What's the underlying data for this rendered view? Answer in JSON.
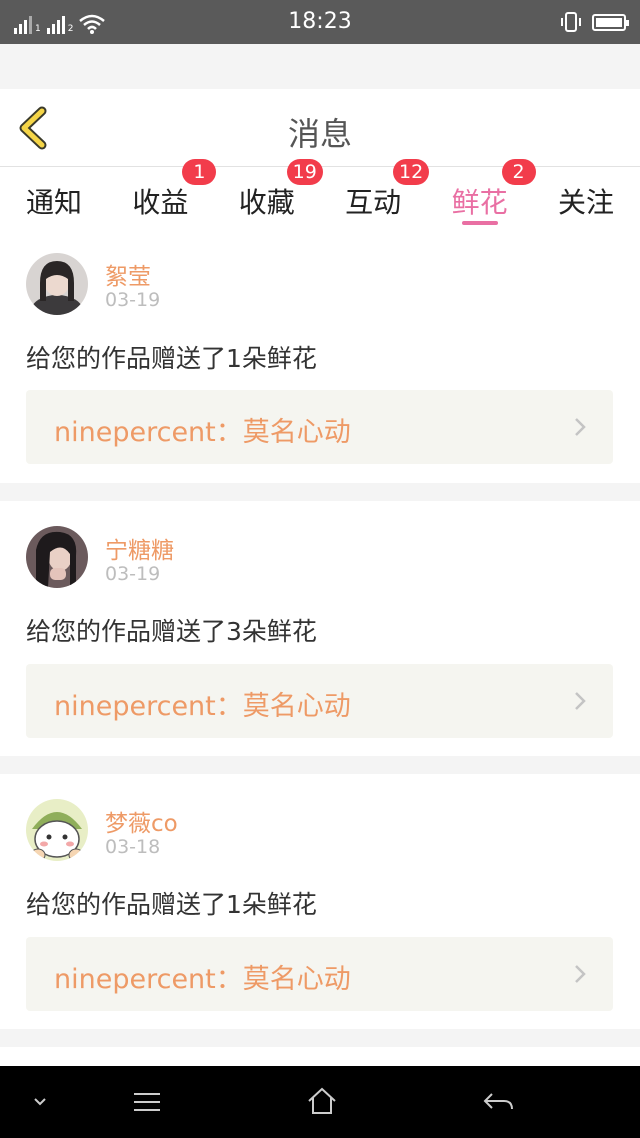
{
  "status_bar": {
    "time": "18:23",
    "sim1_label": "1",
    "sim2_label": "2"
  },
  "header": {
    "title": "消息",
    "back_icon": "chevron-left-icon"
  },
  "tabs": [
    {
      "label": "通知",
      "badge": null,
      "active": false
    },
    {
      "label": "收益",
      "badge": "1",
      "active": false
    },
    {
      "label": "收藏",
      "badge": "19",
      "active": false
    },
    {
      "label": "互动",
      "badge": "12",
      "active": false
    },
    {
      "label": "鲜花",
      "badge": "2",
      "active": true
    },
    {
      "label": "关注",
      "badge": null,
      "active": false
    }
  ],
  "messages": [
    {
      "user": "絮莹",
      "date": "03-19",
      "text": "给您的作品赠送了1朵鲜花",
      "work": "ninepercent：莫名心动"
    },
    {
      "user": "宁糖糖",
      "date": "03-19",
      "text": "给您的作品赠送了3朵鲜花",
      "work": "ninepercent：莫名心动"
    },
    {
      "user": "梦薇co",
      "date": "03-18",
      "text": "给您的作品赠送了1朵鲜花",
      "work": "ninepercent：莫名心动"
    }
  ],
  "colors": {
    "accent_pink": "#e96fa3",
    "username_orange": "#ee9a66",
    "badge_red": "#f23c4b",
    "back_icon_yellow": "#f5d547"
  },
  "system_nav": {
    "icons": [
      "chevron-down-icon",
      "menu-icon",
      "home-icon",
      "back-arrow-icon"
    ]
  }
}
